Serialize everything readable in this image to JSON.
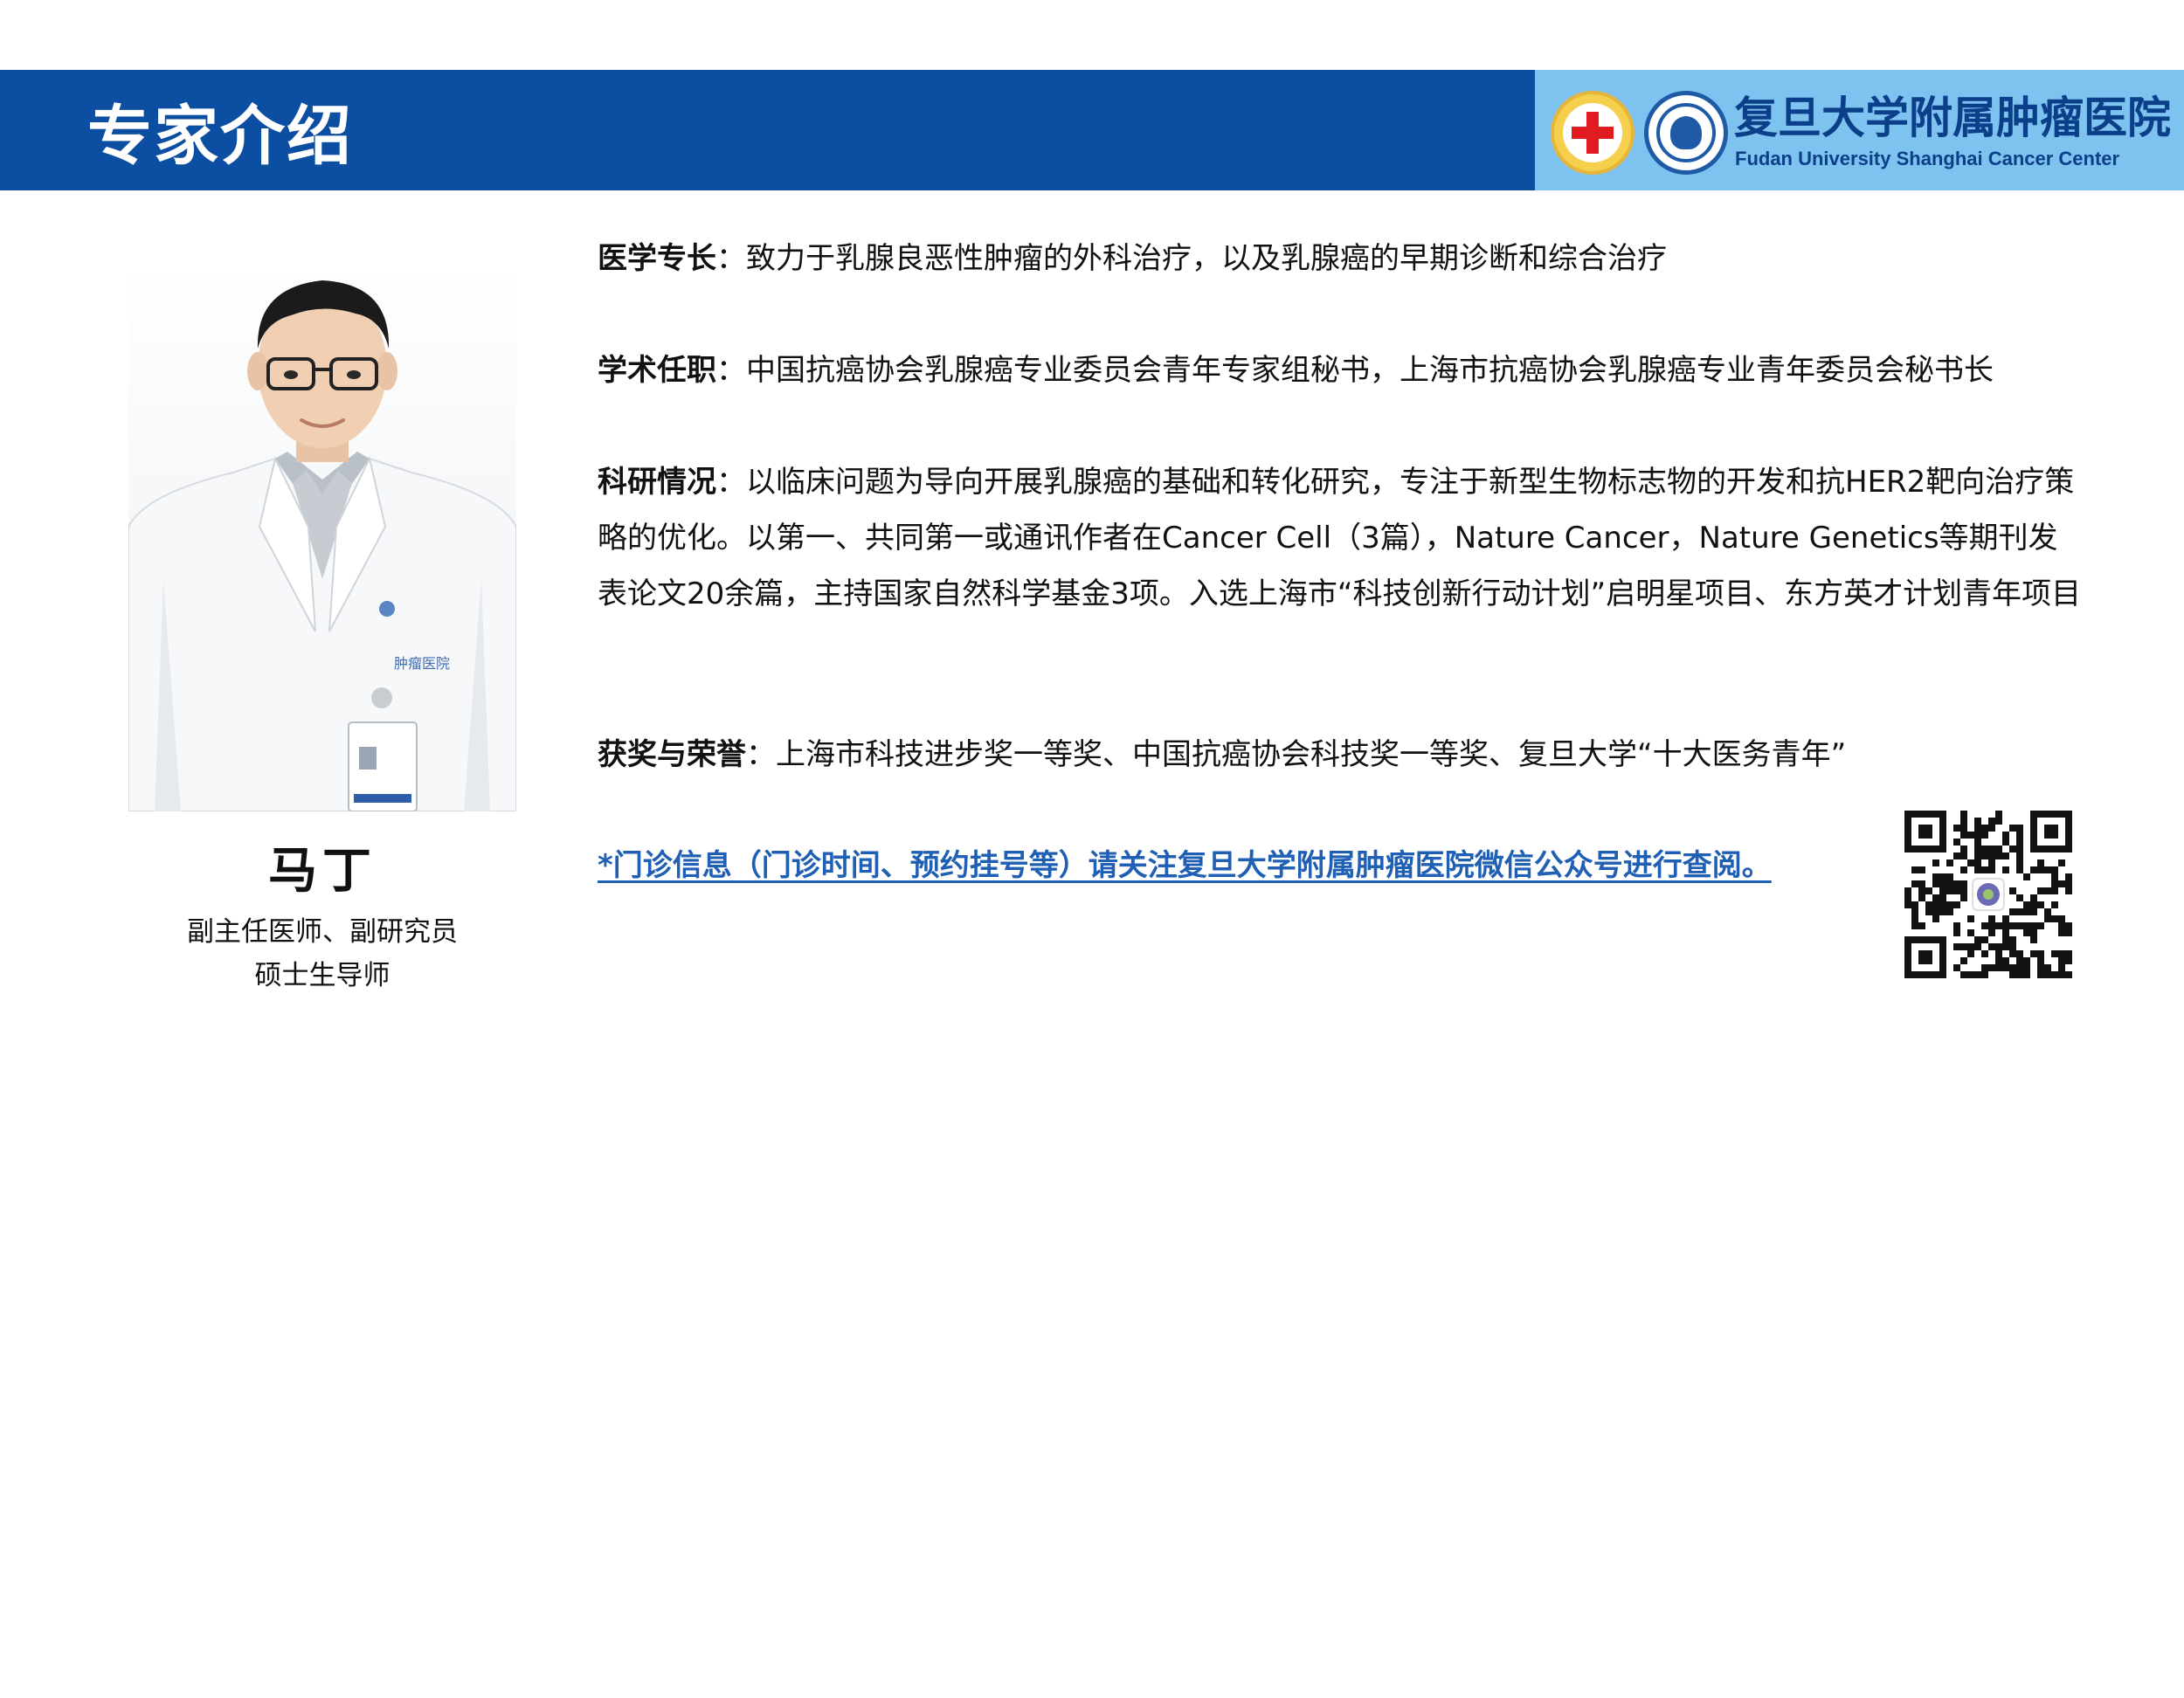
{
  "header": {
    "title": "专家介绍",
    "accent_color": "#0b4ea2",
    "logo_panel_color": "#7ec2ef",
    "hospital_name_cn": "复旦大学附属肿瘤医院",
    "hospital_name_en": "Fudan University Shanghai Cancer Center"
  },
  "doctor": {
    "name": "马丁",
    "title": "副主任医师、副研究员",
    "role": "硕士生导师",
    "badge_text": "肿瘤医院"
  },
  "sections": {
    "expertise": {
      "label": "医学专长",
      "separator": "：",
      "text": "致力于乳腺良恶性肿瘤的外科治疗，以及乳腺癌的早期诊断和综合治疗"
    },
    "academic": {
      "label": "学术任职",
      "separator": "：",
      "text": "中国抗癌协会乳腺癌专业委员会青年专家组秘书，上海市抗癌协会乳腺癌专业青年委员会秘书长"
    },
    "research": {
      "label": "科研情况",
      "separator": "：",
      "text": "以临床问题为导向开展乳腺癌的基础和转化研究，专注于新型生物标志物的开发和抗HER2靶向治疗策略的优化。以第一、共同第一或通讯作者在Cancer Cell（3篇），Nature Cancer，Nature Genetics等期刊发表论文20余篇，主持国家自然科学基金3项。入选上海市“科技创新行动计划”启明星项目、东方英才计划青年项目"
    },
    "awards": {
      "label": "获奖与荣誉",
      "separator": "：",
      "text": "上海市科技进步奖一等奖、中国抗癌协会科技奖一等奖、复旦大学“十大医务青年”"
    }
  },
  "clinic_note": "*门诊信息（门诊时间、预约挂号等）请关注复旦大学附属肿瘤医院微信公众号进行查阅。",
  "link_color": "#1f5fb4"
}
